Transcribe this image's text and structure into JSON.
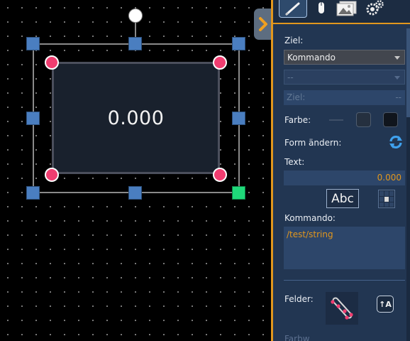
{
  "canvas": {
    "widget_value": "0.000"
  },
  "panel": {
    "tabs": [
      {
        "icon": "pencil-icon",
        "active": true
      },
      {
        "icon": "mouse-icon",
        "active": false
      },
      {
        "icon": "image-icon",
        "active": false
      },
      {
        "icon": "gears-icon",
        "active": false
      }
    ],
    "ziel_label": "Ziel:",
    "ziel_dropdown": "Kommando",
    "sub_dropdown": "--",
    "ziel_field_label": "Ziel:",
    "ziel_field_value": "--",
    "farbe_label": "Farbe:",
    "form_label": "Form ändern:",
    "text_label": "Text:",
    "text_value": "0.000",
    "abc_button": "Abc",
    "kommando_label": "Kommando:",
    "kommando_value": "/test/string",
    "felder_label": "Felder:",
    "aa_button": "↑A",
    "farbw_label": "Farbw"
  },
  "colors": {
    "accent": "#e2971d",
    "panel_bg": "#223652",
    "handle_blue": "#4a7ec0",
    "handle_pink": "#f03d70",
    "handle_green": "#1fd97a"
  }
}
